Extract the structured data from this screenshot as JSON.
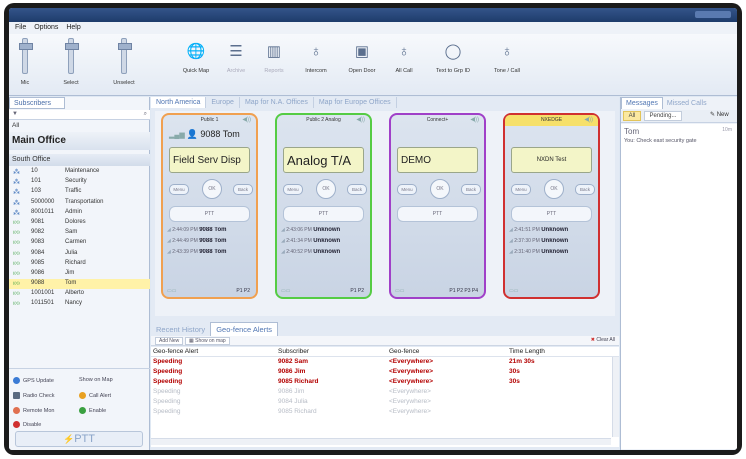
{
  "titlebar": {
    "title": ""
  },
  "menu": [
    "File",
    "Options",
    "Help"
  ],
  "ribbon": {
    "sliders": [
      {
        "label": "Mic"
      },
      {
        "label": "Select"
      },
      {
        "label": "Unselect"
      }
    ],
    "buttons": [
      {
        "label": "Quick Map",
        "icon": "map-icon"
      },
      {
        "label": "Archive",
        "icon": "archive-icon"
      },
      {
        "label": "Reports",
        "icon": "reports-icon"
      },
      {
        "label": "Intercom",
        "icon": "intercom-icon"
      },
      {
        "label": "Open Door",
        "icon": "open-door-icon"
      },
      {
        "label": "All Call",
        "icon": "all-call-icon"
      },
      {
        "label": "Text to Grp ID",
        "icon": "text-group-icon"
      },
      {
        "label": "Tone / Call",
        "icon": "tone-call-icon"
      }
    ]
  },
  "left": {
    "tab": "Subscribers",
    "all": "All",
    "group": "Main Office",
    "subgroup": "South Office",
    "subscribers": [
      {
        "id": "10",
        "name": "Maintenance",
        "type": "group"
      },
      {
        "id": "101",
        "name": "Security",
        "type": "group"
      },
      {
        "id": "103",
        "name": "Traffic",
        "type": "group"
      },
      {
        "id": "5000000",
        "name": "Transportation",
        "type": "group"
      },
      {
        "id": "8001011",
        "name": "Admin",
        "type": "group"
      },
      {
        "id": "9081",
        "name": "Dolores",
        "type": "radio"
      },
      {
        "id": "9082",
        "name": "Sam",
        "type": "radio"
      },
      {
        "id": "9083",
        "name": "Carmen",
        "type": "radio"
      },
      {
        "id": "9084",
        "name": "Julia",
        "type": "radio"
      },
      {
        "id": "9085",
        "name": "Richard",
        "type": "radio"
      },
      {
        "id": "9086",
        "name": "Jim",
        "type": "radio"
      },
      {
        "id": "9088",
        "name": "Tom",
        "type": "radio",
        "selected": true
      },
      {
        "id": "1001001",
        "name": "Alberto",
        "type": "radio"
      },
      {
        "id": "1011501",
        "name": "Nancy",
        "type": "radio"
      }
    ],
    "actions": {
      "gps_update": "GPS Update",
      "show_on_map": "Show on Map",
      "radio_check": "Radio Check",
      "call_alert": "Call Alert",
      "remote_mon": "Remote Mon",
      "enable": "Enable",
      "disable": "Disable"
    },
    "ptt": "PTT"
  },
  "center": {
    "tabs": [
      "North America",
      "Europe",
      "Map for N.A. Offices",
      "Map for Europe Offices"
    ],
    "cards": [
      {
        "title": "Public 1",
        "border": "#f0a050",
        "display": "Field Serv Disp",
        "display_style": "normal",
        "caller": "9088 Tom",
        "show_caller": true,
        "history": [
          {
            "time": "2:44:09 PM",
            "who": "9088 Tom"
          },
          {
            "time": "2:44:49 PM",
            "who": "9088 Tom"
          },
          {
            "time": "2:43:39 PM",
            "who": "9088 Tom"
          }
        ],
        "footer": "P1  P2"
      },
      {
        "title": "Public 2 Analog",
        "border": "#55cc44",
        "display": "Analog T/A",
        "display_style": "big",
        "caller": "",
        "show_caller": false,
        "history": [
          {
            "time": "2:43:06 PM",
            "who": "Unknown"
          },
          {
            "time": "2:41:34 PM",
            "who": "Unknown"
          },
          {
            "time": "2:40:52 PM",
            "who": "Unknown"
          }
        ],
        "footer": "P1  P2"
      },
      {
        "title": "Connect+",
        "border": "#a040c8",
        "display": "DEMO",
        "display_style": "normal",
        "caller": "",
        "show_caller": false,
        "history": [],
        "footer": "P1  P2  P3  P4"
      },
      {
        "title": "NXEDGE",
        "border": "#d03030",
        "header_bg": "#f6e06a",
        "display": "NXDN Test",
        "display_style": "small",
        "caller": "",
        "show_caller": false,
        "history": [
          {
            "time": "2:41:51 PM",
            "who": "Unknown"
          },
          {
            "time": "2:37:30 PM",
            "who": "Unknown"
          },
          {
            "time": "2:31:40 PM",
            "who": "Unknown"
          }
        ],
        "footer": ""
      }
    ],
    "card_buttons": {
      "menu": "Menu",
      "ok": "OK",
      "back": "Back",
      "ptt": "PTT"
    },
    "bottom_tabs": [
      "Recent History",
      "Geo-fence Alerts"
    ],
    "toolbar": {
      "add": "Add New",
      "show_map": "Show on map",
      "clear": "Clear All"
    },
    "columns": [
      "Geo-fence Alert",
      "Subscriber",
      "Geo-fence",
      "Time Length"
    ],
    "rows": [
      {
        "alert": "Speeding",
        "subscriber": "9082 Sam",
        "fence": "<Everywhere>",
        "time": "21m 30s",
        "state": "active"
      },
      {
        "alert": "Speeding",
        "subscriber": "9086 Jim",
        "fence": "<Everywhere>",
        "time": "30s",
        "state": "active"
      },
      {
        "alert": "Speeding",
        "subscriber": "9085 Richard",
        "fence": "<Everywhere>",
        "time": "30s",
        "state": "active"
      },
      {
        "alert": "Speeding",
        "subscriber": "9086 Jim",
        "fence": "<Everywhere>",
        "time": "",
        "state": "muted"
      },
      {
        "alert": "Speeding",
        "subscriber": "9084 Julia",
        "fence": "<Everywhere>",
        "time": "",
        "state": "muted"
      },
      {
        "alert": "Speeding",
        "subscriber": "9085 Richard",
        "fence": "<Everywhere>",
        "time": "",
        "state": "muted"
      }
    ]
  },
  "right": {
    "tabs": [
      "Messages",
      "Missed Calls"
    ],
    "filter_all": "All",
    "filter_pending": "Pending...",
    "new": "New",
    "message": {
      "from": "Tom",
      "time": "10m",
      "text": "You: Check east security gate"
    }
  }
}
